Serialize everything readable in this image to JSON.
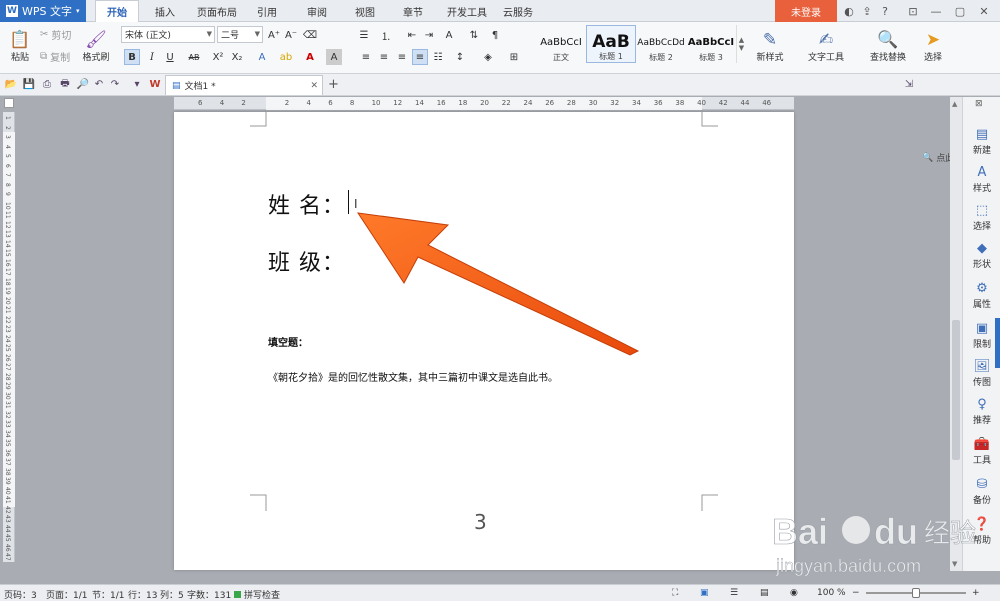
{
  "title_bar": {
    "app_name": "WPS 文字",
    "tabs": [
      "开始",
      "插入",
      "页面布局",
      "引用",
      "审阅",
      "视图",
      "章节",
      "开发工具",
      "云服务"
    ],
    "active_tab": "开始",
    "login_label": "未登录"
  },
  "ribbon": {
    "paste_label": "粘贴",
    "cut_label": "剪切",
    "copy_label": "复制",
    "format_painter_label": "格式刷",
    "font_name": "宋体 (正文)",
    "font_size": "二号",
    "styles": [
      {
        "preview": "AaBbCcI",
        "label": "正文"
      },
      {
        "preview": "AaB",
        "label": "标题 1"
      },
      {
        "preview": "AaBbCcDd",
        "label": "标题 2"
      },
      {
        "preview": "AaBbCcI",
        "label": "标题 3"
      }
    ],
    "new_style_label": "新样式",
    "text_tools_label": "文字工具",
    "find_replace_label": "查找替换",
    "select_label": "选择"
  },
  "quick_bar": {
    "doc_tab": "文档1 *",
    "find_command": "点此查找命令"
  },
  "ruler": {
    "h_ticks": [
      "6",
      "4",
      "2",
      "",
      "2",
      "4",
      "6",
      "8",
      "10",
      "12",
      "14",
      "16",
      "18",
      "20",
      "22",
      "24",
      "26",
      "28",
      "30",
      "32",
      "34",
      "36",
      "38",
      "40",
      "42",
      "44",
      "46"
    ],
    "v_ticks": [
      "1",
      "2",
      "3",
      "4",
      "5",
      "6",
      "7",
      "8",
      "9",
      "10",
      "11",
      "12",
      "13",
      "14",
      "15",
      "16",
      "17",
      "18",
      "19",
      "20",
      "21",
      "22",
      "23",
      "24",
      "25",
      "26",
      "27",
      "28",
      "29",
      "30",
      "31",
      "32",
      "33",
      "34",
      "35",
      "36",
      "37",
      "38",
      "39",
      "40",
      "41",
      "42",
      "43",
      "44",
      "45",
      "46",
      "47"
    ]
  },
  "document": {
    "line1": "姓 名：",
    "line2": "班 级：",
    "heading": "填空题：",
    "body": "《朝花夕拾》是的回忆性散文集，其中三篇初中课文是选自此书。",
    "page_number": "3"
  },
  "right_panel": [
    "新建",
    "样式",
    "选择",
    "形状",
    "属性",
    "限制",
    "传图",
    "推荐",
    "工具",
    "备份",
    "帮助"
  ],
  "status_bar": {
    "page_code": "页码：3",
    "pages": "页面：1/1",
    "section": "节：1/1",
    "row": "行：13",
    "col": "列：5",
    "word_count": "字数：131",
    "spell_check": "拼写检查",
    "zoom": "100 %"
  },
  "watermark": {
    "brand": "Bai du 经验",
    "url": "jingyan.baidu.com"
  },
  "colors": {
    "accent": "#2f6fc4",
    "login": "#e8603c",
    "arrow": "#f05a14"
  }
}
